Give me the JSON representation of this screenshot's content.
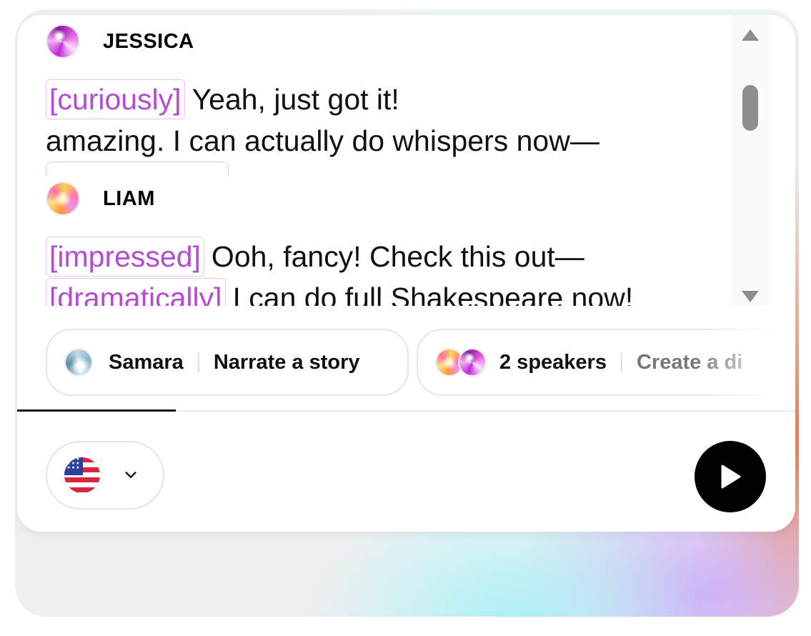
{
  "transcript": {
    "speakers": [
      {
        "name": "JESSICA",
        "lines": [
          {
            "tag": "[curiously]",
            "text": "Yeah, just got it!"
          },
          {
            "tag": "",
            "text": "amazing. I can actually do whispers now—"
          }
        ]
      },
      {
        "name": "LIAM",
        "lines": [
          {
            "tag": "[impressed]",
            "text": "Ooh, fancy! Check this out—"
          },
          {
            "tag": "[dramatically]",
            "text": "I can do full Shakespeare now!"
          }
        ]
      }
    ]
  },
  "presets": [
    {
      "label": "Samara",
      "action": "Narrate a story"
    },
    {
      "label": "2 speakers",
      "action": "Create a di"
    }
  ],
  "controls": {
    "language_flag": "us-flag-icon",
    "dropdown_icon": "chevron-down-icon",
    "play_icon": "play-icon"
  },
  "colors": {
    "tag_text": "#b54ad6",
    "tag_border": "#ecc4f4",
    "play_button": "#000000"
  }
}
